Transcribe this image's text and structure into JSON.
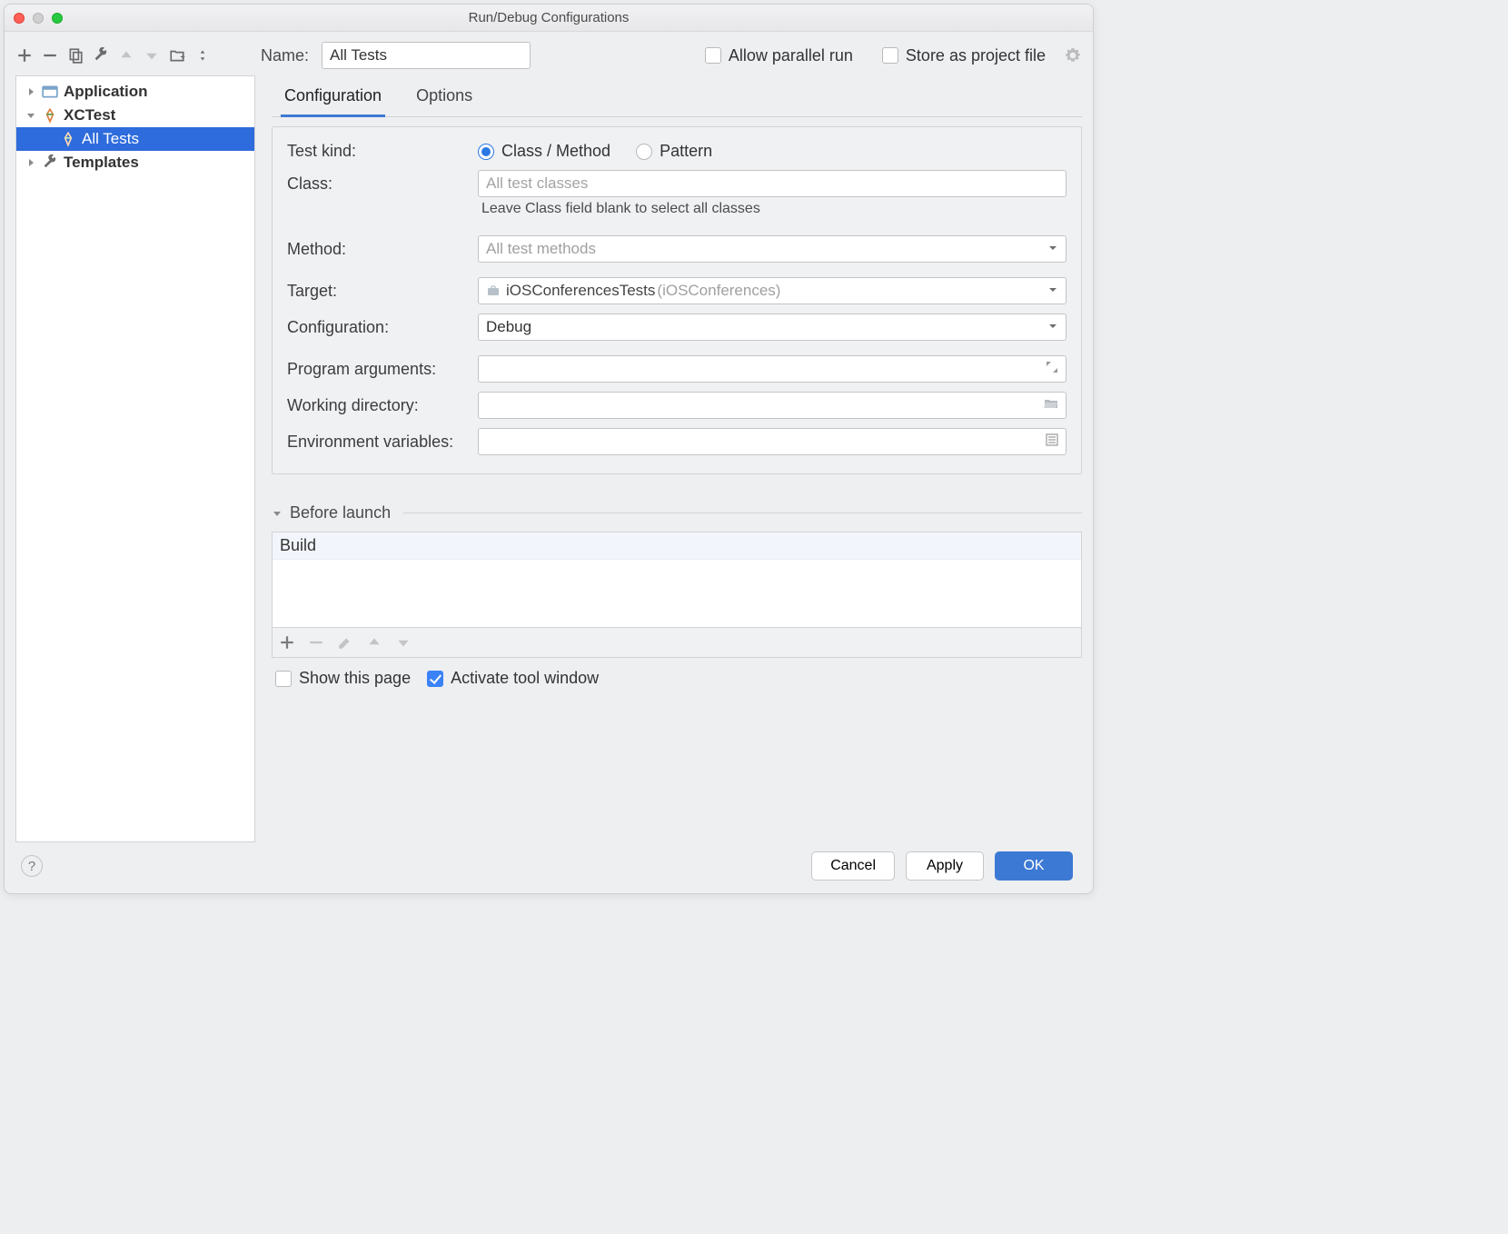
{
  "window": {
    "title": "Run/Debug Configurations"
  },
  "nameRow": {
    "label": "Name:",
    "value": "All Tests",
    "allowParallel": "Allow parallel run",
    "storeProject": "Store as project file"
  },
  "tree": {
    "application": "Application",
    "xctest": "XCTest",
    "alltests": "All Tests",
    "templates": "Templates"
  },
  "tabs": {
    "configuration": "Configuration",
    "options": "Options"
  },
  "form": {
    "testKindLabel": "Test kind:",
    "radioClass": "Class / Method",
    "radioPattern": "Pattern",
    "classLabel": "Class:",
    "classPlaceholder": "All test classes",
    "classHelper": "Leave Class field blank to select all classes",
    "methodLabel": "Method:",
    "methodValue": "All test methods",
    "targetLabel": "Target:",
    "targetValue": "iOSConferencesTests",
    "targetParen": "(iOSConferences)",
    "configLabel": "Configuration:",
    "configValue": "Debug",
    "progArgsLabel": "Program arguments:",
    "workDirLabel": "Working directory:",
    "envVarsLabel": "Environment variables:"
  },
  "before": {
    "title": "Before launch",
    "item": "Build"
  },
  "afterChecks": {
    "showPage": "Show this page",
    "activateTool": "Activate tool window"
  },
  "footer": {
    "cancel": "Cancel",
    "apply": "Apply",
    "ok": "OK"
  }
}
